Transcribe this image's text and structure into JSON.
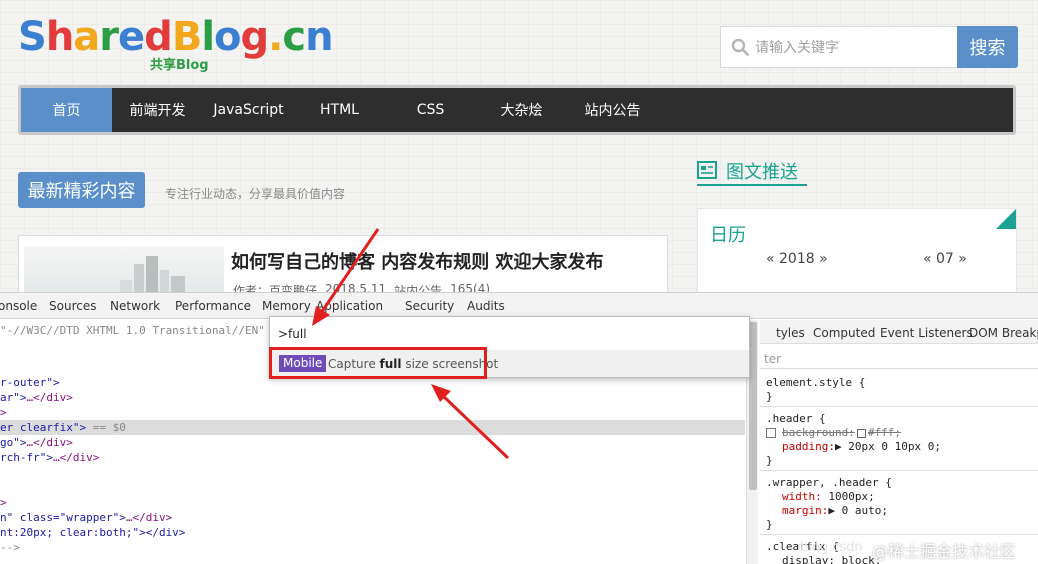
{
  "site": {
    "logo_text": "SharedBlog.cn",
    "logo_sub": "共享Blog",
    "search_placeholder": "请输入关键字",
    "search_button": "搜索"
  },
  "nav": {
    "items": [
      {
        "label": "首页",
        "active": true
      },
      {
        "label": "前端开发",
        "active": false
      },
      {
        "label": "JavaScript",
        "active": false
      },
      {
        "label": "HTML",
        "active": false
      },
      {
        "label": "CSS",
        "active": false
      },
      {
        "label": "大杂烩",
        "active": false
      },
      {
        "label": "站内公告",
        "active": false
      }
    ]
  },
  "main": {
    "section_title": "最新精彩内容",
    "section_subtitle": "专注行业动态，分享最具价值内容",
    "post": {
      "title": "如何写自己的博客 内容发布规则 欢迎大家发布",
      "author": "作者：百变鹏仔",
      "date": "2018.5.11",
      "category": "站内公告",
      "views": "165(4)"
    }
  },
  "sidebar": {
    "heading": "图文推送",
    "calendar_title": "日历",
    "year": "« 2018 »",
    "month": "« 07 »"
  },
  "devtools": {
    "tabs": [
      "onsole",
      "Sources",
      "Network",
      "Performance",
      "Memory",
      "Application",
      "Security",
      "Audits"
    ],
    "command_input": ">full",
    "result_badge": "Mobile",
    "result_text_pre": "Capture ",
    "result_text_bold": "full",
    "result_text_post": " size screenshot",
    "code": {
      "doctype": "\"-//W3C//DTD XHTML 1.0 Transitional//EN\"",
      "l2": "r-outer\">",
      "l3a": "ar\">",
      "l3b": "…</div>",
      "l4": ">",
      "l5a": "er clearfix\">",
      "l5b": " == $0",
      "l6a": "go\">",
      "l6b": "…</div>",
      "l7a": "rch-fr\">",
      "l7b": "…</div>",
      "l8": ">",
      "l9a": "n\" class=\"wrapper\">",
      "l9b": "…</div>",
      "l10": "nt:20px; clear:both;\"></div>",
      "l11": "-->"
    },
    "styles_tabs": [
      "tyles",
      "Computed",
      "Event Listeners",
      "DOM Breakpo"
    ],
    "filter": "ter",
    "rules": {
      "r1": "element.style {",
      "r1_close": "}",
      "r2": ".header {",
      "r2_p1_name": "background:",
      "r2_p1_val": "#fff;",
      "r2_p2_name": "padding:",
      "r2_p2_val": "▶ 20px 0 10px 0;",
      "r2_close": "}",
      "r3": ".wrapper, .header {",
      "r3_p1_name": "width:",
      "r3_p1_val": " 1000px;",
      "r3_p2_name": "margin:",
      "r3_p2_val": "▶ 0 auto;",
      "r3_close": "}",
      "r4": ".clearfix {",
      "r4_p1": "display: block;"
    }
  },
  "watermark": "@稀土掘金技术社区",
  "watermark_faint": "blog.csdn"
}
